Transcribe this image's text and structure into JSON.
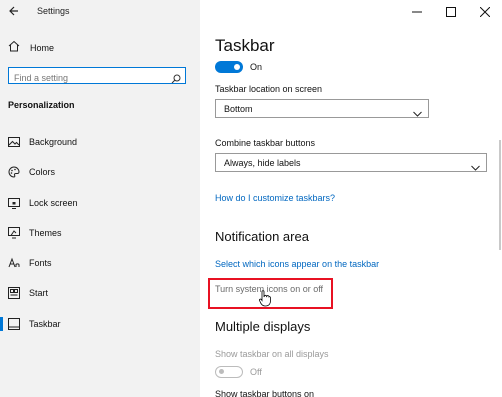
{
  "window": {
    "title": "Settings"
  },
  "sidebar": {
    "home_label": "Home",
    "search_placeholder": "Find a setting",
    "section_label": "Personalization",
    "items": [
      {
        "label": "Background",
        "icon": "image-icon"
      },
      {
        "label": "Colors",
        "icon": "palette-icon"
      },
      {
        "label": "Lock screen",
        "icon": "lock-screen-icon"
      },
      {
        "label": "Themes",
        "icon": "brush-icon"
      },
      {
        "label": "Fonts",
        "icon": "font-icon"
      },
      {
        "label": "Start",
        "icon": "start-icon"
      },
      {
        "label": "Taskbar",
        "icon": "taskbar-icon",
        "selected": true
      }
    ]
  },
  "main": {
    "title": "Taskbar",
    "top_toggle": {
      "state_label": "On",
      "on": true
    },
    "location": {
      "label": "Taskbar location on screen",
      "value": "Bottom"
    },
    "combine": {
      "label": "Combine taskbar buttons",
      "value": "Always, hide labels"
    },
    "customize_link": "How do I customize taskbars?",
    "notification": {
      "heading": "Notification area",
      "select_icons_link": "Select which icons appear on the taskbar",
      "system_icons_link": "Turn system icons on or off"
    },
    "multiple_displays": {
      "heading": "Multiple displays",
      "show_all_label": "Show taskbar on all displays",
      "show_all_toggle": {
        "state_label": "Off",
        "on": false
      },
      "buttons_label": "Show taskbar buttons on"
    }
  },
  "colors": {
    "accent": "#0078d7",
    "link": "#0067c0",
    "highlight_box": "#e81123",
    "sidebar_bg": "#f2f2f2"
  }
}
